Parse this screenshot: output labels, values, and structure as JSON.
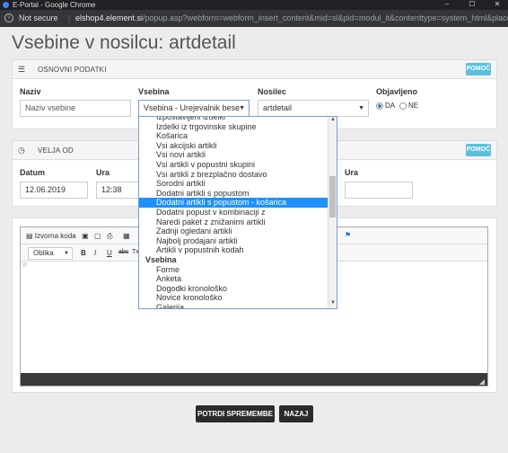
{
  "window": {
    "title": "E-Portal - Google Chrome",
    "minimize": "–",
    "maximize": "☐",
    "close": "✕"
  },
  "address": {
    "security": "Not secure",
    "separator": "|",
    "host": "elshop4.element.si",
    "path": "/popup.asp?webform=webform_insert_content&mid=sl&pid=modul_it&contenttype=system_html&placehold..."
  },
  "page": {
    "title": "Vsebine v nosilcu: artdetail"
  },
  "basic_panel": {
    "heading": "OSNOVNI PODATKI",
    "help": "POMOČ",
    "naziv_label": "Naziv",
    "naziv_placeholder": "Naziv vsebine",
    "vsebina_label": "Vsebina",
    "vsebina_value": "Vsebina - Urejevalnik bese",
    "nosilec_label": "Nosilec",
    "nosilec_value": "artdetail",
    "objavljeno_label": "Objavljeno",
    "da": "DA",
    "ne": "NE"
  },
  "validity_panel": {
    "heading": "VELJA OD",
    "help": "POMOČ",
    "datum_label": "Datum",
    "datum_value": "12.06.2019",
    "ura_label": "Ura",
    "ura_value": "12:38",
    "ura2_label": "Ura",
    "ura2_value": ""
  },
  "editor": {
    "source_label": "Izvorna koda",
    "format_value": "Oblika",
    "bold": "B",
    "italic": "I",
    "underline": "U",
    "strike": "abc",
    "clear": "Tx",
    "body_tag": "P"
  },
  "dropdown": {
    "items": [
      {
        "label": "Izpostavljeni izdelki",
        "type": "item"
      },
      {
        "label": "Izdelki iz trgovinske skupine",
        "type": "item"
      },
      {
        "label": "Košarica",
        "type": "item"
      },
      {
        "label": "Vsi akcijski artikli",
        "type": "item"
      },
      {
        "label": "Vsi novi artikli",
        "type": "item"
      },
      {
        "label": "Vsi artikli v popustni skupini",
        "type": "item"
      },
      {
        "label": "Vsi artikli z brezplačno dostavo",
        "type": "item"
      },
      {
        "label": "Sorodni artikli",
        "type": "item"
      },
      {
        "label": "Dodatni artikli s popustom",
        "type": "item"
      },
      {
        "label": "Dodatni artikli s popustom - košarica",
        "type": "selected"
      },
      {
        "label": "Dodatni popust v kombinaciji z",
        "type": "item"
      },
      {
        "label": "Naredi paket z znižanimi artikli",
        "type": "item"
      },
      {
        "label": "Zadnji ogledani artikli",
        "type": "item"
      },
      {
        "label": "Najbolj prodajani artikli",
        "type": "item"
      },
      {
        "label": "Artikli v popustnih kodah",
        "type": "item"
      },
      {
        "label": "Vsebina",
        "type": "group"
      },
      {
        "label": "Forme",
        "type": "item"
      },
      {
        "label": "Anketa",
        "type": "item"
      },
      {
        "label": "Dogodki kronološko",
        "type": "item"
      },
      {
        "label": "Novice kronološko",
        "type": "item"
      },
      {
        "label": "Galerija",
        "type": "item"
      }
    ]
  },
  "actions": {
    "confirm": "POTRDI SPREMEMBE",
    "back": "NAZAJ"
  },
  "colors": {
    "help_button": "#5bc0de",
    "selected_option": "#1e90ff",
    "action_button": "#2b2b2b"
  }
}
